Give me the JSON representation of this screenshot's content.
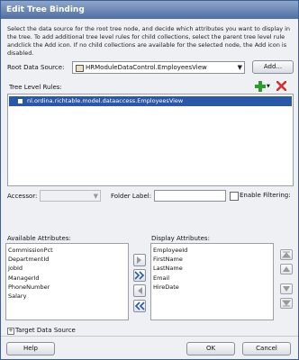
{
  "window": {
    "title": "Edit Tree Binding"
  },
  "description": "Select the data source for the root tree node, and decide which attributes you want to display in the tree. To add additional tree level rules for child collections, select the parent tree level rule andclick the Add icon. If no child collections are available for the selected node, the Add icon is disabled.",
  "root_data_source": {
    "label": "Root Data Source:",
    "value": "HRModuleDataControl.EmployeesView",
    "add_button": "Add..."
  },
  "tree_level_rules": {
    "label": "Tree Level Rules:",
    "selected_rule": "nl.ordina.richtable.model.dataaccess.EmployeesView"
  },
  "accessor": {
    "label": "Accessor:",
    "value": ""
  },
  "folder_label": {
    "label": "Folder Label:",
    "value": ""
  },
  "enable_filtering": {
    "label": "Enable Filtering:",
    "checked": false
  },
  "available": {
    "label": "Available Attributes:",
    "items": [
      "CommissionPct",
      "DepartmentId",
      "JobId",
      "ManagerId",
      "PhoneNumber",
      "Salary"
    ]
  },
  "display": {
    "label": "Display Attributes:",
    "items": [
      "EmployeeId",
      "FirstName",
      "LastName",
      "Email",
      "HireDate"
    ]
  },
  "target_data_source": {
    "label": "Target Data Source"
  },
  "footer": {
    "help": "Help",
    "ok": "OK",
    "cancel": "Cancel"
  },
  "colors": {
    "accent": "#2b57a7",
    "add": "#2e9b2e",
    "delete": "#d32f2f",
    "title_bar": "#4f6ea3"
  }
}
